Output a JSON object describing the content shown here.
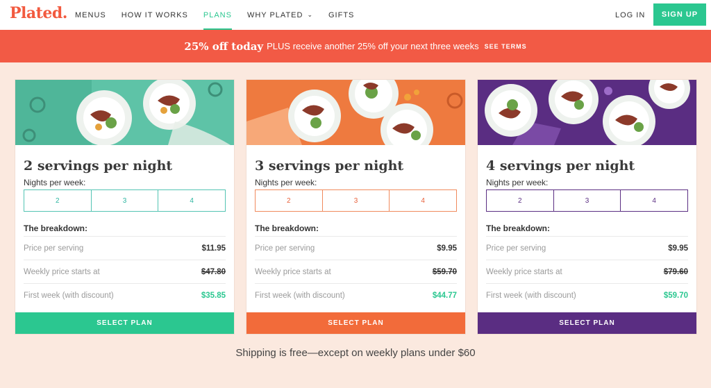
{
  "brand": {
    "logo": "Plated."
  },
  "nav": {
    "items": [
      {
        "label": "MENUS"
      },
      {
        "label": "HOW IT WORKS"
      },
      {
        "label": "PLANS"
      },
      {
        "label": "WHY PLATED"
      },
      {
        "label": "GIFTS"
      }
    ],
    "login": "LOG IN",
    "signup": "SIGN UP"
  },
  "promo": {
    "bold": "25% off today",
    "rest": "PLUS receive another 25% off your next three weeks",
    "terms": "SEE TERMS"
  },
  "colors": {
    "brand_red": "#f25a3f",
    "green": "#2bc790",
    "orange": "#f26b3a",
    "purple": "#5a2d82",
    "teal": "#53c4a9"
  },
  "plans": [
    {
      "title": "2 servings per night",
      "nights_label": "Nights per week:",
      "nights": [
        "2",
        "3",
        "4"
      ],
      "breakdown_label": "The breakdown:",
      "rows": [
        {
          "label": "Price per serving",
          "value": "$11.95"
        },
        {
          "label": "Weekly price starts at",
          "value": "$47.80"
        },
        {
          "label": "First week (with discount)",
          "value": "$35.85"
        }
      ],
      "cta": "SELECT PLAN"
    },
    {
      "title": "3 servings per night",
      "nights_label": "Nights per week:",
      "nights": [
        "2",
        "3",
        "4"
      ],
      "breakdown_label": "The breakdown:",
      "rows": [
        {
          "label": "Price per serving",
          "value": "$9.95"
        },
        {
          "label": "Weekly price starts at",
          "value": "$59.70"
        },
        {
          "label": "First week (with discount)",
          "value": "$44.77"
        }
      ],
      "cta": "SELECT PLAN"
    },
    {
      "title": "4 servings per night",
      "nights_label": "Nights per week:",
      "nights": [
        "2",
        "3",
        "4"
      ],
      "breakdown_label": "The breakdown:",
      "rows": [
        {
          "label": "Price per serving",
          "value": "$9.95"
        },
        {
          "label": "Weekly price starts at",
          "value": "$79.60"
        },
        {
          "label": "First week (with discount)",
          "value": "$59.70"
        }
      ],
      "cta": "SELECT PLAN"
    }
  ],
  "shipping_note": "Shipping is free—except on weekly plans under $60"
}
